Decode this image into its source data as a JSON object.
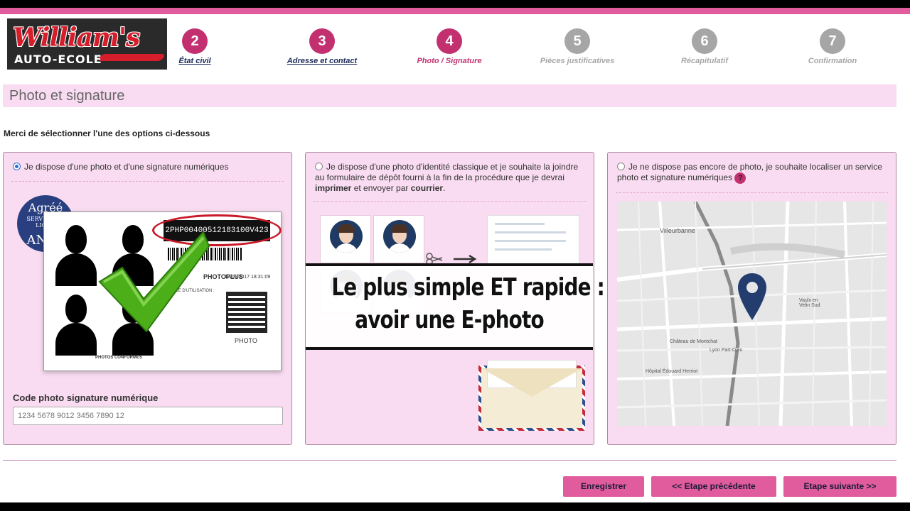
{
  "logo": {
    "brand": "William's",
    "subtitle": "AUTO-ECOLE"
  },
  "steps": [
    {
      "number": "2",
      "label": "État civil",
      "state": "done"
    },
    {
      "number": "3",
      "label": "Adresse et contact",
      "state": "done"
    },
    {
      "number": "4",
      "label": "Photo / Signature",
      "state": "current"
    },
    {
      "number": "5",
      "label": "Pièces justificatives",
      "state": "todo"
    },
    {
      "number": "6",
      "label": "Récapitulatif",
      "state": "todo"
    },
    {
      "number": "7",
      "label": "Confirmation",
      "state": "todo"
    }
  ],
  "section_title": "Photo et signature",
  "instruction": "Merci de sélectionner l'une des options ci-dessous",
  "options": {
    "digital": {
      "label": "Je dispose d'une photo et d'une signature numériques",
      "selected": true,
      "badge": {
        "line1": "Agréé",
        "line2": "SERVICE EN LIGNE",
        "line3": "ANTS"
      },
      "card": {
        "code": "2PHP004005121831​00V423",
        "date": "12/05/2017 18:31:09",
        "brand": "PHOTOPLUS",
        "notice_title": "NOTICE D'UTILISATION :",
        "footer": "PHOTOS CONFORMES",
        "ephoto": "PHOTO"
      },
      "code_label": "Code photo signature numérique",
      "code_placeholder": "1234 5678 9012 3456 7890 12"
    },
    "classic": {
      "label_pre": "Je dispose d'une photo d'identité classique et je souhaite la joindre au formulaire de dépôt fourni à la fin de la procédure que je devrai ",
      "label_bold1": "imprimer",
      "label_mid": " et envoyer par ",
      "label_bold2": "courrier",
      "label_post": ".",
      "selected": false
    },
    "locate": {
      "label": "Je ne dispose pas encore de photo, je souhaite localiser un service photo et signature numériques",
      "help": "?",
      "selected": false,
      "map_labels": [
        "Villeurbanne",
        "Vaulx en Velin Sud",
        "Château de Montchat",
        "Hôpital Édouard Herriot",
        "Lyon Part-Dieu"
      ]
    }
  },
  "overlay": {
    "line1": "Le plus simple ET rapide :",
    "line2": "avoir une E-photo"
  },
  "buttons": {
    "save": "Enregistrer",
    "prev": "<<  Etape précédente",
    "next": "Etape suivante  >>"
  },
  "colors": {
    "accent": "#c2306f",
    "pink_bar": "#e05c9c",
    "panel_bg": "#f9dcf1",
    "disabled": "#a6a6a6"
  }
}
